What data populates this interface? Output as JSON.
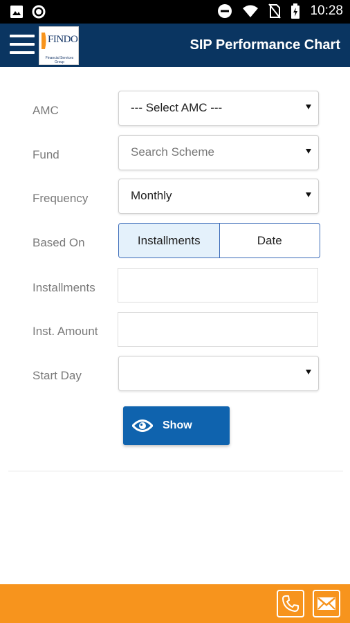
{
  "status_bar": {
    "time": "10:28",
    "icons": [
      "image-icon",
      "circle-icon",
      "do-not-disturb-icon",
      "wifi-icon",
      "no-sim-icon",
      "battery-charging-icon"
    ]
  },
  "app_bar": {
    "menu_icon": "hamburger-menu-icon",
    "logo_text": "FINDOC",
    "logo_subtext": "Financial Services Group",
    "title": "SIP Performance Chart"
  },
  "form": {
    "amc": {
      "label": "AMC",
      "value": "--- Select AMC ---"
    },
    "fund": {
      "label": "Fund",
      "placeholder": "Search Scheme"
    },
    "frequency": {
      "label": "Frequency",
      "value": "Monthly"
    },
    "based_on": {
      "label": "Based On",
      "options": [
        "Installments",
        "Date"
      ],
      "selected": "Installments"
    },
    "installments": {
      "label": "Installments",
      "value": ""
    },
    "inst_amount": {
      "label": "Inst. Amount",
      "value": ""
    },
    "start_day": {
      "label": "Start Day",
      "value": ""
    },
    "show_button": {
      "label": "Show",
      "icon": "eye-icon"
    }
  },
  "footer": {
    "icons": [
      "phone-icon",
      "mail-icon"
    ],
    "background": "#f7941d"
  },
  "colors": {
    "app_bar": "#0a3561",
    "button": "#0f63ae",
    "accent": "#f7941d"
  }
}
